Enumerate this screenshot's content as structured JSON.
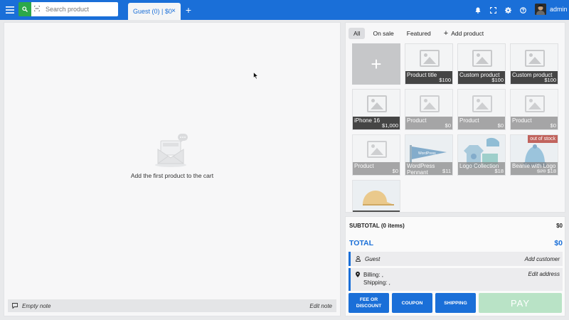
{
  "topbar": {
    "search_placeholder": "Search product",
    "cart_tab_label": "Guest (0) | $0",
    "cart_tab_close": "×",
    "add_tab": "+",
    "user_name": "admin"
  },
  "cart": {
    "empty_message": "Add the first product to the cart",
    "note_label": "Empty note",
    "note_edit": "Edit note"
  },
  "products": {
    "filters": [
      {
        "label": "All",
        "active": true
      },
      {
        "label": "On sale",
        "active": false
      },
      {
        "label": "Featured",
        "active": false
      }
    ],
    "add_product_label": "Add product",
    "add_product_icon": "+",
    "tiles": [
      {
        "name": "Product title",
        "price": "$100",
        "style": "dark"
      },
      {
        "name": "Custom product",
        "price": "$100",
        "style": "dark"
      },
      {
        "name": "Custom product",
        "price": "$100",
        "style": "dark"
      },
      {
        "name": "iPhone 16",
        "price": "$1,000",
        "style": "dark"
      },
      {
        "name": "Product",
        "price": "$0",
        "style": "grey"
      },
      {
        "name": "Product",
        "price": "$0",
        "style": "grey"
      },
      {
        "name": "Product",
        "price": "$0",
        "style": "grey"
      },
      {
        "name": "Product",
        "price": "$0",
        "style": "grey"
      },
      {
        "name": "WordPress Pennant",
        "price": "$11",
        "style": "grey"
      },
      {
        "name": "Logo Collection",
        "price": "$18",
        "style": "grey"
      },
      {
        "name": "Beanie with Logo",
        "old_price": "$20",
        "price": "$18",
        "style": "grey",
        "badge": "out of stock"
      }
    ]
  },
  "totals": {
    "subtotal_label": "SUBTOTAL (0 items)",
    "subtotal_value": "$0",
    "total_label": "TOTAL",
    "total_value": "$0",
    "customer_name": "Guest",
    "add_customer": "Add customer",
    "billing": "Billing: ,",
    "shipping": "Shipping: ,",
    "edit_address": "Edit address"
  },
  "actions": {
    "fee_discount": "FEE OR DISCOUNT",
    "coupon": "COUPON",
    "shipping": "SHIPPING",
    "pay": "PAY"
  },
  "colors": {
    "primary": "#1a6fd8",
    "search_button": "#2ca84a",
    "pay_disabled": "#b9e3c6",
    "out_of_stock": "#b84b44"
  }
}
